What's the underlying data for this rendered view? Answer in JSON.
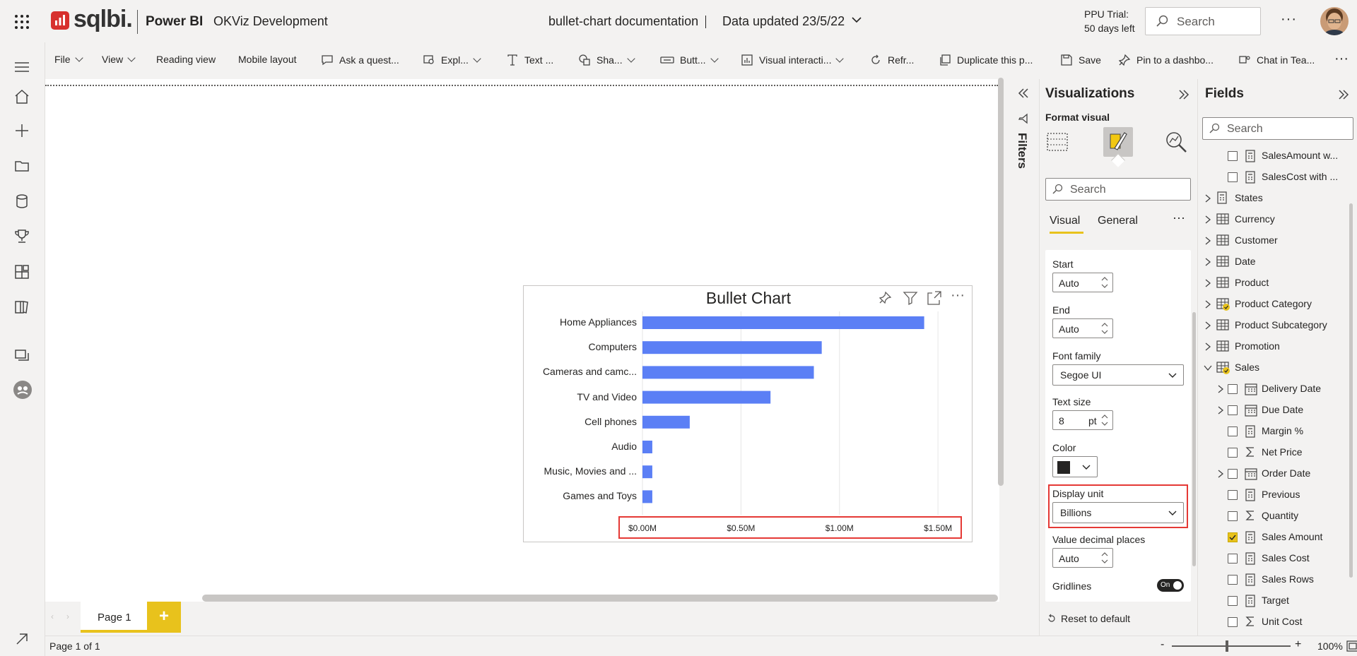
{
  "header": {
    "brand": "sqlbi.",
    "product": "Power BI",
    "workspace": "OKViz Development",
    "report_title": "bullet-chart documentation",
    "data_updated": "Data updated 23/5/22",
    "trial_line1": "PPU Trial:",
    "trial_line2": "50 days left",
    "search_placeholder": "Search"
  },
  "toolbar": {
    "items": [
      "File",
      "View",
      "Reading view",
      "Mobile layout",
      "Ask a quest...",
      "Expl...",
      "Text ...",
      "Sha...",
      "Butt...",
      "Visual interacti...",
      "Refr...",
      "Duplicate this p...",
      "Save",
      "Pin to a dashbo...",
      "Chat in Tea..."
    ]
  },
  "canvas": {
    "visual_header_icons": [
      "pin-icon",
      "filter-icon",
      "focus-mode-icon",
      "more-options-icon"
    ]
  },
  "chart_data": {
    "type": "bar",
    "title": "Bullet Chart",
    "categories": [
      "Home Appliances",
      "Computers",
      "Cameras and camc...",
      "TV and Video",
      "Cell phones",
      "Audio",
      "Music, Movies and ...",
      "Games and Toys"
    ],
    "values": [
      1.43,
      0.91,
      0.87,
      0.65,
      0.24,
      0.05,
      0.05,
      0.05
    ],
    "xlim": [
      0,
      1.6
    ],
    "ticks": [
      0,
      0.5,
      1.0,
      1.5
    ],
    "tick_labels": [
      "$0.00M",
      "$0.50M",
      "$1.00M",
      "$1.50M"
    ],
    "bar_color": "#5b7ff5",
    "grid": true
  },
  "filters": {
    "label": "Filters"
  },
  "visualizations": {
    "title": "Visualizations",
    "subtitle": "Format visual",
    "search_placeholder": "Search",
    "tabs": [
      "Visual",
      "General"
    ],
    "start_label": "Start",
    "start_value": "Auto",
    "end_label": "End",
    "end_value": "Auto",
    "font_family_label": "Font family",
    "font_family_value": "Segoe UI",
    "text_size_label": "Text size",
    "text_size_value": "8",
    "text_size_unit": "pt",
    "color_label": "Color",
    "color_value": "#252423",
    "display_unit_label": "Display unit",
    "display_unit_value": "Billions",
    "decimal_label": "Value decimal places",
    "decimal_value": "Auto",
    "gridlines_label": "Gridlines",
    "gridlines_toggle": "On",
    "reset": "Reset to default"
  },
  "fields": {
    "title": "Fields",
    "search_placeholder": "Search",
    "items": [
      {
        "label": "SalesAmount w...",
        "kind": "measure",
        "indent": 2,
        "checked": false
      },
      {
        "label": "SalesCost with ...",
        "kind": "measure",
        "indent": 2,
        "checked": false
      },
      {
        "label": "States",
        "kind": "measure-table",
        "indent": 0,
        "checked": false
      },
      {
        "label": "Currency",
        "kind": "table",
        "indent": 0,
        "checked": false
      },
      {
        "label": "Customer",
        "kind": "table",
        "indent": 0,
        "checked": false
      },
      {
        "label": "Date",
        "kind": "table",
        "indent": 0,
        "checked": false
      },
      {
        "label": "Product",
        "kind": "table",
        "indent": 0,
        "checked": false
      },
      {
        "label": "Product Category",
        "kind": "table-used",
        "indent": 0,
        "checked": false
      },
      {
        "label": "Product Subcategory",
        "kind": "table",
        "indent": 0,
        "checked": false
      },
      {
        "label": "Promotion",
        "kind": "table",
        "indent": 0,
        "checked": false
      },
      {
        "label": "Sales",
        "kind": "table-used-open",
        "indent": 0,
        "checked": false
      },
      {
        "label": "Delivery Date",
        "kind": "date",
        "indent": 1,
        "checked": false
      },
      {
        "label": "Due Date",
        "kind": "date",
        "indent": 1,
        "checked": false
      },
      {
        "label": "Margin %",
        "kind": "measure",
        "indent": 2,
        "checked": false
      },
      {
        "label": "Net Price",
        "kind": "sigma",
        "indent": 2,
        "checked": false
      },
      {
        "label": "Order Date",
        "kind": "date",
        "indent": 1,
        "checked": false
      },
      {
        "label": "Previous",
        "kind": "measure",
        "indent": 2,
        "checked": false
      },
      {
        "label": "Quantity",
        "kind": "sigma",
        "indent": 2,
        "checked": false
      },
      {
        "label": "Sales Amount",
        "kind": "measure",
        "indent": 2,
        "checked": true
      },
      {
        "label": "Sales Cost",
        "kind": "measure",
        "indent": 2,
        "checked": false
      },
      {
        "label": "Sales Rows",
        "kind": "measure",
        "indent": 2,
        "checked": false
      },
      {
        "label": "Target",
        "kind": "measure",
        "indent": 2,
        "checked": false
      },
      {
        "label": "Unit Cost",
        "kind": "sigma",
        "indent": 2,
        "checked": false
      }
    ]
  },
  "pages": {
    "tab": "Page 1",
    "add": "+",
    "status": "Page 1 of 1",
    "zoom": "100%"
  }
}
